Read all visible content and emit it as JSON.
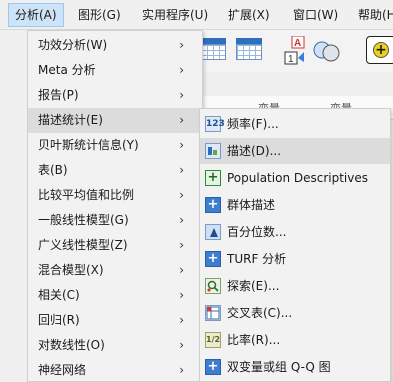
{
  "menubar": [
    {
      "label": "分析(A)",
      "active": true
    },
    {
      "label": "图形(G)"
    },
    {
      "label": "实用程序(U)"
    },
    {
      "label": "扩展(X)"
    },
    {
      "label": "窗口(W)"
    },
    {
      "label": "帮助(H)"
    }
  ],
  "grid_headers": [
    "变量",
    "变量"
  ],
  "analyze_menu": [
    {
      "label": "功效分析(W)",
      "arrow": "›"
    },
    {
      "label": "Meta 分析",
      "arrow": "›"
    },
    {
      "label": "报告(P)",
      "arrow": "›"
    },
    {
      "label": "描述统计(E)",
      "arrow": "›",
      "highlighted": true
    },
    {
      "label": "贝叶斯统计信息(Y)",
      "arrow": "›"
    },
    {
      "label": "表(B)",
      "arrow": "›"
    },
    {
      "label": "比较平均值和比例",
      "arrow": "›"
    },
    {
      "label": "一般线性模型(G)",
      "arrow": "›"
    },
    {
      "label": "广义线性模型(Z)",
      "arrow": "›"
    },
    {
      "label": "混合模型(X)",
      "arrow": "›"
    },
    {
      "label": "相关(C)",
      "arrow": "›"
    },
    {
      "label": "回归(R)",
      "arrow": "›"
    },
    {
      "label": "对数线性(O)",
      "arrow": "›"
    },
    {
      "label": "神经网络",
      "arrow": "›"
    }
  ],
  "descriptive_submenu": [
    {
      "label": "频率(F)...",
      "icon": "frequencies-icon",
      "glyph": "123"
    },
    {
      "label": "描述(D)...",
      "icon": "descriptives-icon",
      "glyph": "",
      "highlighted": true
    },
    {
      "label": "Population Descriptives",
      "icon": "population-descriptives-icon",
      "glyph": "+"
    },
    {
      "label": "群体描述",
      "icon": "group-descriptives-icon",
      "glyph": "+"
    },
    {
      "label": "百分位数...",
      "icon": "percentiles-icon",
      "glyph": ""
    },
    {
      "label": "TURF 分析",
      "icon": "turf-icon",
      "glyph": "+"
    },
    {
      "label": "探索(E)...",
      "icon": "explore-icon",
      "glyph": "●"
    },
    {
      "label": "交叉表(C)...",
      "icon": "crosstabs-icon",
      "glyph": "⊞"
    },
    {
      "label": "比率(R)...",
      "icon": "ratio-icon",
      "glyph": "1/2"
    },
    {
      "label": "双变量或组 Q-Q 图",
      "icon": "qq-plot-icon",
      "glyph": "+"
    }
  ]
}
